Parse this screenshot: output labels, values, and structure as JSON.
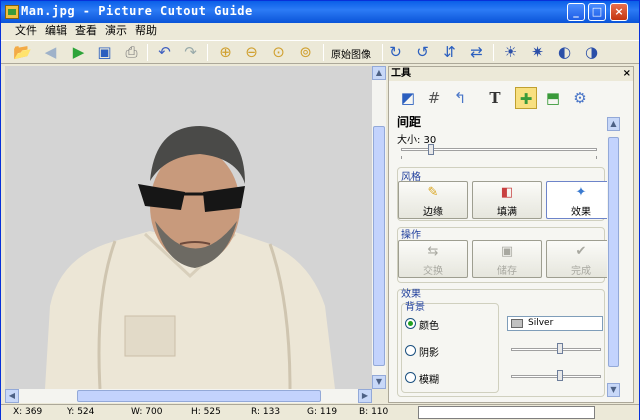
{
  "window": {
    "title": "Man.jpg - Picture Cutout Guide",
    "min": "_",
    "max": "□",
    "close": "×"
  },
  "menu": [
    "文件",
    "编辑",
    "查看",
    "演示",
    "帮助"
  ],
  "toolbar": {
    "original_label": "原始图像"
  },
  "panel": {
    "title": "工具",
    "close": "×",
    "section_spacing": "间距",
    "size_label": "大小: 30",
    "size_value": 30,
    "style_label": "风格",
    "style_buttons": [
      "边缘",
      "填满",
      "效果"
    ],
    "ops_label": "操作",
    "ops_buttons": [
      "交换",
      "储存",
      "完成"
    ],
    "effect_label": "效果",
    "bg_label": "背景",
    "radios": [
      "颜色",
      "阴影",
      "模糊"
    ],
    "color_value": "Silver"
  },
  "status": {
    "x": "X: 369",
    "y": "Y: 524",
    "w": "W: 700",
    "h": "H: 525",
    "r": "R: 133",
    "g": "G: 119",
    "b": "B: 110"
  },
  "colors": {
    "title_blue": "#0a5fe8",
    "canvas_gray": "#d4d4d4",
    "silver": "#c0c0c0"
  }
}
